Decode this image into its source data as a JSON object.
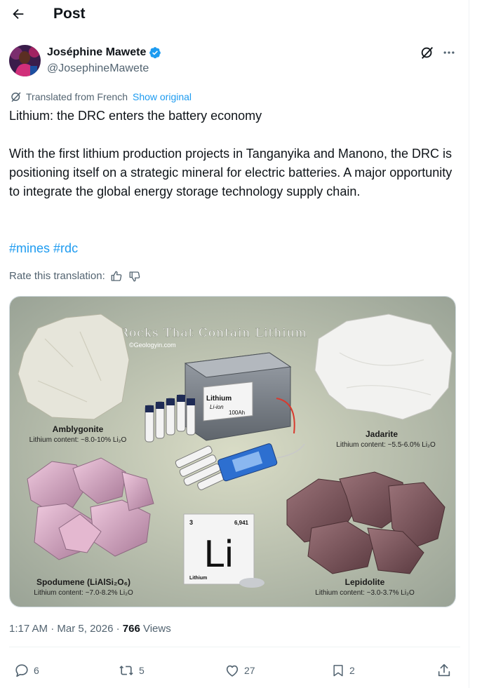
{
  "header": {
    "title": "Post"
  },
  "author": {
    "name": "Joséphine Mawete",
    "handle": "@JosephineMawete"
  },
  "translation": {
    "label": "Translated from French",
    "show_original": "Show original",
    "rate_label": "Rate this translation:"
  },
  "post": {
    "title_line": "Lithium: the DRC enters the battery economy",
    "body": "With the first lithium production projects in Tanganyika and Manono, the DRC is positioning itself on a strategic mineral for electric batteries. A major opportunity to integrate the global energy storage technology supply chain.",
    "hashtags": [
      "#mines",
      "#rdc"
    ]
  },
  "image": {
    "title": "Rocks That Contain Lithium",
    "credit": "©Geologyin.com",
    "minerals": [
      {
        "name": "Amblygonite",
        "content": "Lithium content: ~8.0-10% Li₂O"
      },
      {
        "name": "Jadarite",
        "content": "Lithium content: ~5.5-6.0% Li₂O"
      },
      {
        "name": "Spodumene (LiAlSi₂O₆)",
        "content": "Lithium content: ~7.0-8.2% Li₂O"
      },
      {
        "name": "Lepidolite",
        "content": "Lithium content: ~3.0-3.7% Li₂O"
      }
    ],
    "battery_label_1": "Lithium",
    "battery_label_2": "Li-ion",
    "battery_label_3": "100Ah",
    "element": {
      "number": "3",
      "mass": "6,941",
      "symbol": "Li",
      "name": "Lithium"
    }
  },
  "meta": {
    "time": "1:17 AM",
    "sep1": " · ",
    "date": "Mar 5, 2026",
    "sep2": " · ",
    "views_count": "766",
    "views_label": " Views"
  },
  "actions": {
    "replies": "6",
    "reposts": "5",
    "likes": "27",
    "bookmarks": "2"
  },
  "colors": {
    "accent": "#1d9bf0",
    "text": "#0f1419",
    "muted": "#536471"
  }
}
